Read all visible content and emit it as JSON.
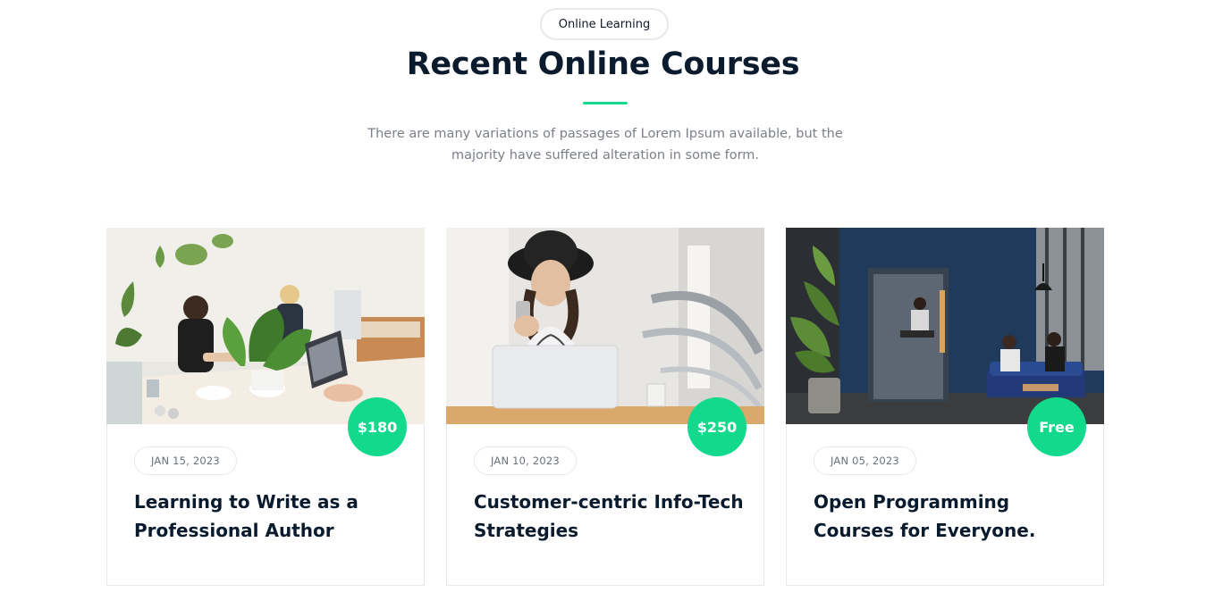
{
  "section": {
    "eyebrow": "Online Learning",
    "title": "Recent Online Courses",
    "subtitle": "There are many variations of passages of Lorem Ipsum available, but the majority have suffered alteration in some form."
  },
  "colors": {
    "accent": "#12d98b",
    "heading": "#0b1b2e",
    "muted": "#7a7f87"
  },
  "courses": [
    {
      "price": "$180",
      "date": "JAN 15, 2023",
      "title": "Learning to Write as a Professional Author",
      "image": "coworking-office-photo"
    },
    {
      "price": "$250",
      "date": "JAN 10, 2023",
      "title": "Customer-centric Info-Tech Strategies",
      "image": "woman-with-phone-laptop-photo"
    },
    {
      "price": "Free",
      "date": "JAN 05, 2023",
      "title": "Open Programming Courses for Everyone.",
      "image": "office-lounge-photo"
    }
  ]
}
